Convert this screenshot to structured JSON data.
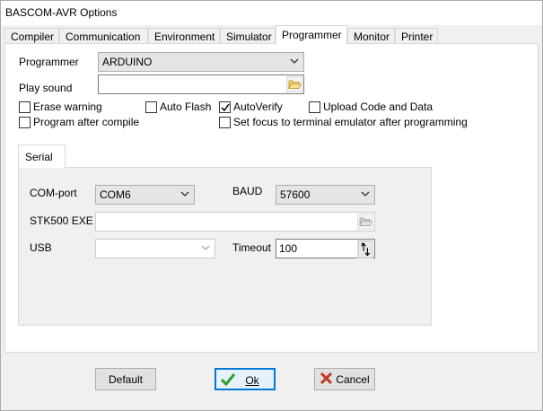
{
  "window": {
    "title": "BASCOM-AVR Options"
  },
  "tabs": [
    {
      "label": "Compiler"
    },
    {
      "label": "Communication"
    },
    {
      "label": "Environment"
    },
    {
      "label": "Simulator"
    },
    {
      "label": "Programmer"
    },
    {
      "label": "Monitor"
    },
    {
      "label": "Printer"
    }
  ],
  "active_tab": "Programmer",
  "programmer": {
    "programmer_label": "Programmer",
    "programmer_value": "ARDUINO",
    "play_sound_label": "Play sound",
    "play_sound_value": "",
    "checkboxes": [
      {
        "label": "Erase warning",
        "checked": false
      },
      {
        "label": "Auto Flash",
        "checked": false
      },
      {
        "label": "AutoVerify",
        "checked": true
      },
      {
        "label": "Upload Code and Data",
        "checked": false
      },
      {
        "label": "Program after compile",
        "checked": false
      },
      {
        "label": "Set focus to terminal emulator after programming",
        "checked": false
      }
    ]
  },
  "serial": {
    "tab_label": "Serial",
    "com_port_label": "COM-port",
    "com_port_value": "COM6",
    "baud_label": "BAUD",
    "baud_value": "57600",
    "stk500_label": "STK500 EXE",
    "stk500_value": "",
    "usb_label": "USB",
    "usb_value": "",
    "timeout_label": "Timeout",
    "timeout_value": "100"
  },
  "buttons": {
    "default_label": "Default",
    "ok_label": "Ok",
    "cancel_label": "Cancel"
  },
  "colors": {
    "focus_border": "#0078d7",
    "ok_check": "#2e9e2e",
    "cancel_x": "#c0392b"
  }
}
